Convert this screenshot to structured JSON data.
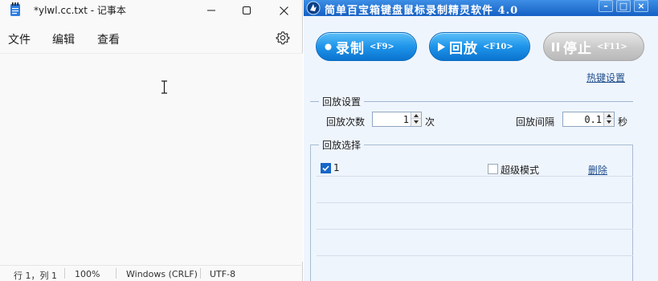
{
  "notepad": {
    "title": "*ylwl.cc.txt - 记事本",
    "menu": [
      "文件",
      "编辑",
      "查看"
    ],
    "status": {
      "position": "行 1，列 1",
      "zoom": "100%",
      "line_ending": "Windows (CRLF)",
      "encoding": "UTF-8"
    }
  },
  "recorder": {
    "title": "简单百宝箱键盘鼠标录制精灵软件  4.0",
    "buttons": {
      "record": {
        "label": "录制",
        "key": "<F9>"
      },
      "play": {
        "label": "回放",
        "key": "<F10>"
      },
      "stop": {
        "label": "停止",
        "key": "<F11>"
      }
    },
    "hotkey_link": "热键设置",
    "playback_settings": {
      "group_label": "回放设置",
      "count_label": "回放次数",
      "count_value": "1",
      "count_unit": "次",
      "interval_label": "回放间隔",
      "interval_value": "0.1",
      "interval_unit": "秒"
    },
    "playback_choice": {
      "group_label": "回放选择",
      "item_label": "1",
      "item_checked": true,
      "super_mode_label": "超级模式",
      "super_mode_checked": false,
      "delete_label": "删除"
    }
  },
  "colors": {
    "title_bar": "#1f6fd0",
    "button_active": "#1e94ea",
    "button_disabled": "#c9c9c9",
    "link": "#1f4e8c",
    "panel_bg": "#eff5fd"
  }
}
